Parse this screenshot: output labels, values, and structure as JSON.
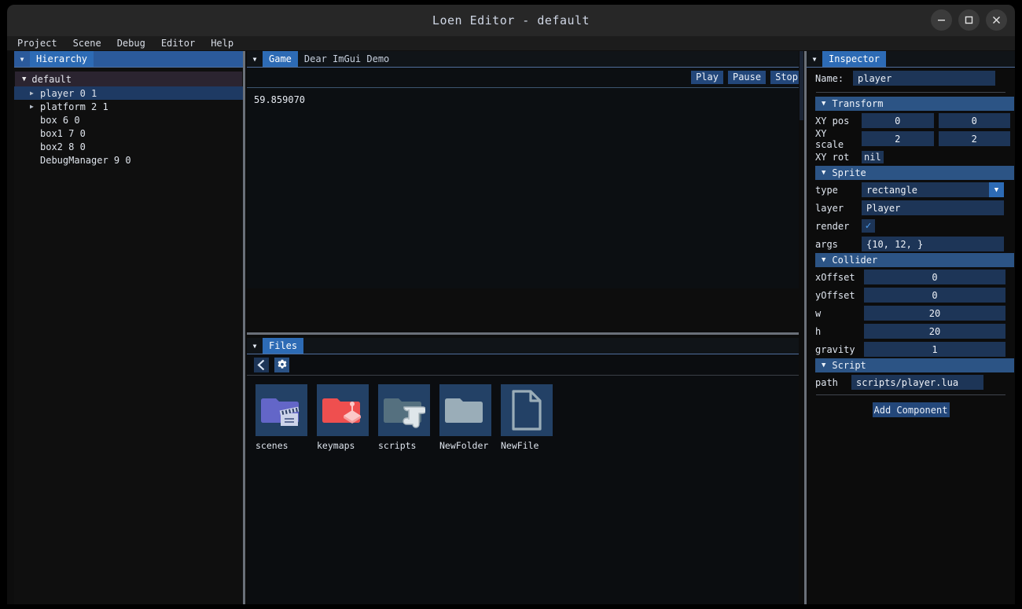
{
  "window": {
    "title": "Loen Editor - default",
    "controls": [
      {
        "name": "minimize",
        "glyph": "minimize-icon"
      },
      {
        "name": "maximize",
        "glyph": "maximize-icon"
      },
      {
        "name": "close",
        "glyph": "close-icon"
      }
    ]
  },
  "menubar": {
    "items": [
      "Project",
      "Scene",
      "Debug",
      "Editor",
      "Help"
    ]
  },
  "hierarchy": {
    "tab": "Hierarchy",
    "dock_icon": "dock-collapse-icon",
    "root": {
      "label": "default",
      "caret": "▼"
    },
    "nodes": [
      {
        "label": "player 0 1",
        "expandable": true,
        "selected": true
      },
      {
        "label": "platform 2 1",
        "expandable": true,
        "selected": false
      },
      {
        "label": "box 6 0",
        "expandable": false,
        "selected": false
      },
      {
        "label": "box1 7 0",
        "expandable": false,
        "selected": false
      },
      {
        "label": "box2 8 0",
        "expandable": false,
        "selected": false
      },
      {
        "label": "DebugManager 9 0",
        "expandable": false,
        "selected": false
      }
    ]
  },
  "game": {
    "dock_icon": "dock-collapse-icon",
    "tabs": [
      {
        "label": "Game",
        "active": true
      },
      {
        "label": "Dear ImGui Demo",
        "active": false
      }
    ],
    "buttons": [
      {
        "label": "Play",
        "name": "play-button"
      },
      {
        "label": "Pause",
        "name": "pause-button"
      },
      {
        "label": "Stop",
        "name": "stop-button"
      }
    ],
    "viewport_text": "59.859070"
  },
  "files": {
    "dock_icon": "dock-collapse-icon",
    "tab": "Files",
    "toolbar": [
      {
        "name": "back-icon",
        "glyph": "❮"
      },
      {
        "name": "gear-icon",
        "glyph": "gear"
      }
    ],
    "items": [
      {
        "label": "scenes",
        "icon": "folder-scenes-icon",
        "kind": "folder",
        "color": "#6366c8",
        "badge": "clapperboard"
      },
      {
        "label": "keymaps",
        "icon": "folder-keymaps-icon",
        "kind": "folder",
        "color": "#ef4f4f",
        "badge": "joystick"
      },
      {
        "label": "scripts",
        "icon": "folder-scripts-icon",
        "kind": "folder",
        "color": "#55707f",
        "badge": "scroll"
      },
      {
        "label": "NewFolder",
        "icon": "folder-icon",
        "kind": "folder",
        "color": "#9aadb8",
        "badge": "none"
      },
      {
        "label": "NewFile",
        "icon": "file-icon",
        "kind": "file",
        "color": "#9aadb8",
        "badge": "none"
      }
    ]
  },
  "inspector": {
    "dock_icon": "dock-collapse-icon",
    "tab": "Inspector",
    "name_label": "Name:",
    "name_value": "player",
    "sections": {
      "transform": {
        "title": "Transform",
        "caret": "▼",
        "xy_pos_label": "XY pos",
        "xy_pos": [
          "0",
          "0"
        ],
        "xy_scale_label": "XY scale",
        "xy_scale": [
          "2",
          "2"
        ],
        "xy_rot_label": "XY rot",
        "xy_rot": "nil"
      },
      "sprite": {
        "title": "Sprite",
        "caret": "▼",
        "type_label": "type",
        "type_value": "rectangle",
        "layer_label": "layer",
        "layer_value": "Player",
        "render_label": "render",
        "render_checked": true,
        "args_label": "args",
        "args_value": "{10, 12, }"
      },
      "collider": {
        "title": "Collider",
        "caret": "▼",
        "fields": [
          {
            "label": "xOffset",
            "value": "0"
          },
          {
            "label": "yOffset",
            "value": "0"
          },
          {
            "label": "w",
            "value": "20"
          },
          {
            "label": "h",
            "value": "20"
          },
          {
            "label": "gravity",
            "value": "1"
          }
        ]
      },
      "script": {
        "title": "Script",
        "caret": "▼",
        "path_label": "path",
        "path_value": "scripts/player.lua"
      }
    },
    "add_component_label": "Add Component"
  },
  "colors": {
    "accent": "#2d6bb5",
    "field": "#1d3557",
    "section_header": "#2c5485",
    "selection": "#1e3a63",
    "titlebar": "#272727"
  }
}
